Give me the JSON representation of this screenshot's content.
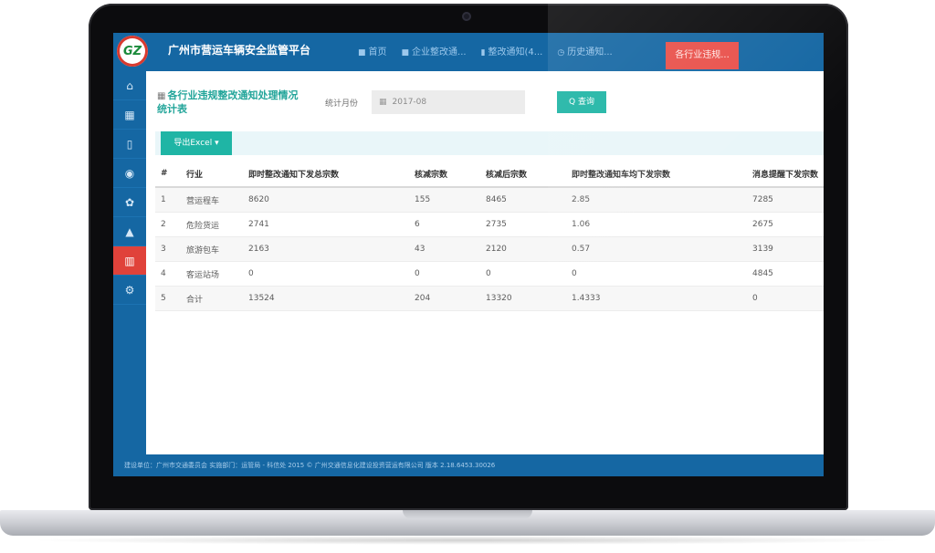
{
  "app": {
    "logo_text": "GZ",
    "title": "广州市营运车辆安全监管平台"
  },
  "nav": [
    {
      "icon": "■",
      "label": "首页"
    },
    {
      "icon": "■",
      "label": "企业整改通..."
    },
    {
      "icon": "▮",
      "label": "整改通知(4..."
    },
    {
      "icon": "◷",
      "label": "历史通知..."
    }
  ],
  "nav_active": {
    "label": "各行业违规..."
  },
  "sidebar": {
    "items": [
      {
        "icon": "⌂",
        "name": "home"
      },
      {
        "icon": "▦",
        "name": "calendar"
      },
      {
        "icon": "▯",
        "name": "document"
      },
      {
        "icon": "◉",
        "name": "camera"
      },
      {
        "icon": "✿",
        "name": "share"
      },
      {
        "icon": "▲",
        "name": "warning"
      },
      {
        "icon": "▥",
        "name": "statistics"
      },
      {
        "icon": "⚙",
        "name": "settings"
      }
    ]
  },
  "page": {
    "title_icon": "▦",
    "title": "各行业违规整改通知处理情况统计表",
    "filter_label": "统计月份",
    "date_icon": "▦",
    "date_value": "2017-08",
    "query_label": "Q 查询",
    "export_label": "导出Excel ▾"
  },
  "table": {
    "headers": [
      "#",
      "行业",
      "即时整改通知下发总宗数",
      "核减宗数",
      "核减后宗数",
      "即时整改通知车均下发宗数",
      "消息提醒下发宗数"
    ],
    "rows": [
      [
        "1",
        "营运程车",
        "8620",
        "155",
        "8465",
        "2.85",
        "7285"
      ],
      [
        "2",
        "危险货运",
        "2741",
        "6",
        "2735",
        "1.06",
        "2675"
      ],
      [
        "3",
        "旅游包车",
        "2163",
        "43",
        "2120",
        "0.57",
        "3139"
      ],
      [
        "4",
        "客运站场",
        "0",
        "0",
        "0",
        "0",
        "4845"
      ],
      [
        "5",
        "合计",
        "13524",
        "204",
        "13320",
        "1.4333",
        "0"
      ]
    ]
  },
  "footer": {
    "text": "建设单位：广州市交通委员会  实施部门：运管局 - 科信处    2015 © 广州交通信息化建设投资营运有限公司 版本 2.18.6453.30026"
  },
  "colors": {
    "primary": "#1567a3",
    "accent": "#1fb5a5",
    "active_red": "#e0423a"
  }
}
